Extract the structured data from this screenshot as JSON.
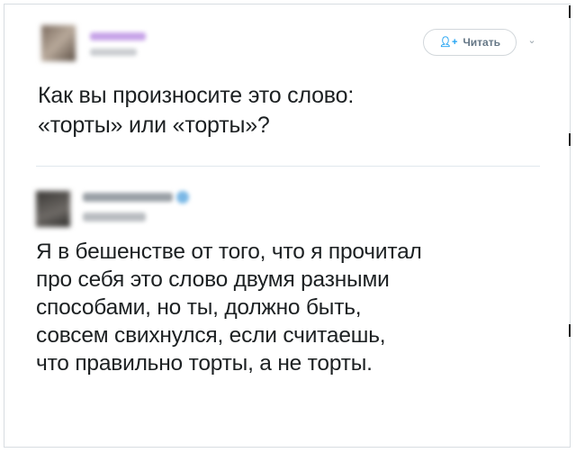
{
  "tweet1": {
    "follow_label": "Читать",
    "follow_icon": "add-user-icon",
    "menu_icon": "chevron-down-icon",
    "line1": "Как вы произносите это слово:",
    "line2": "«торты» или «торты»?"
  },
  "tweet2": {
    "line1": "Я в бешенстве от того, что я прочитал",
    "line2": "про себя это слово двумя разными",
    "line3": "способами, но ты, должно быть,",
    "line4": "совсем свихнулся, если считаешь,",
    "line5": "что правильно торты, а не торты."
  },
  "colors": {
    "accent": "#1da1f2",
    "text": "#1c2022",
    "muted": "#657786",
    "border": "#d8dde1"
  }
}
